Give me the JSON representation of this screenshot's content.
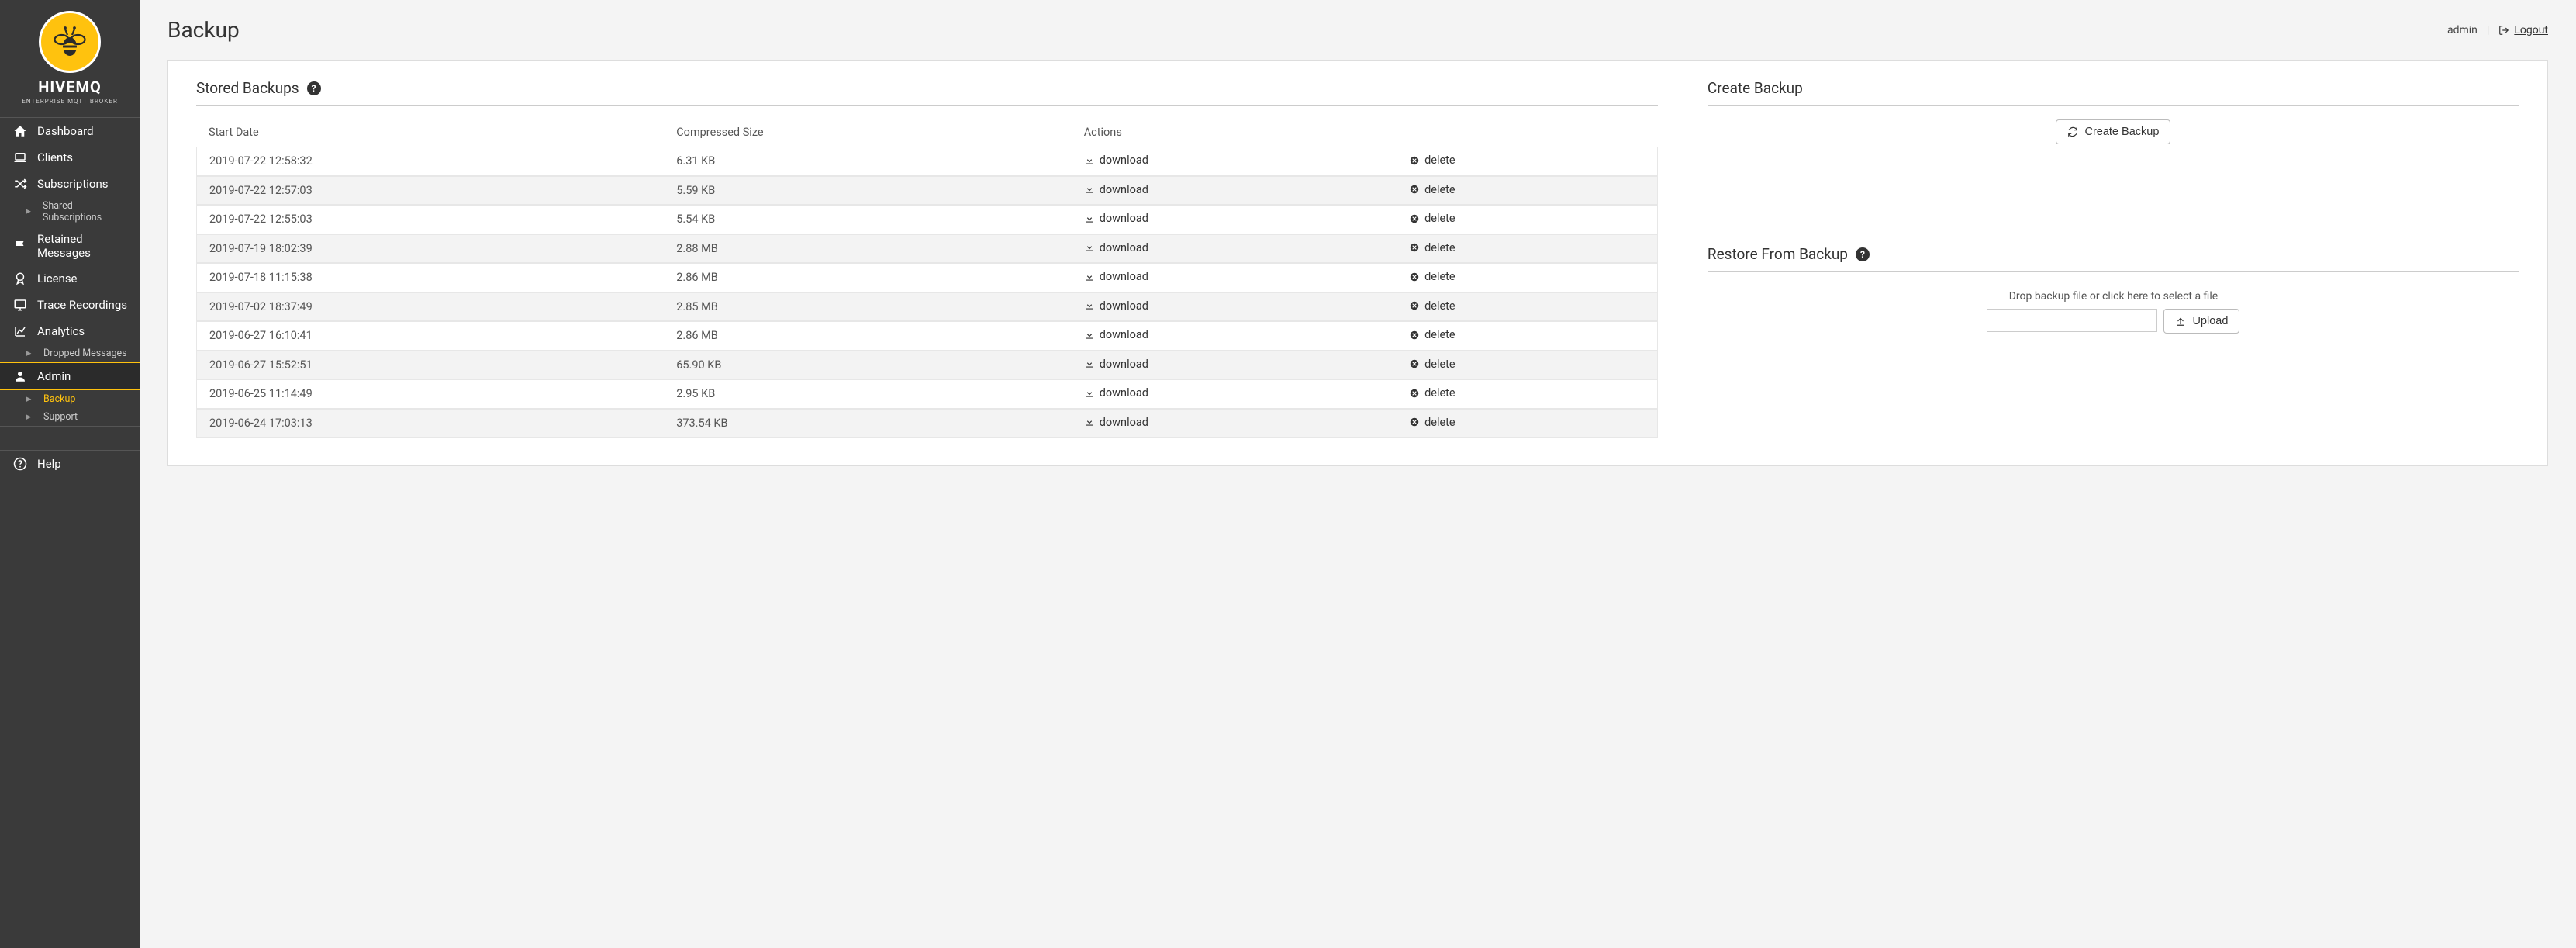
{
  "brand": {
    "name": "HIVEMQ",
    "tagline": "ENTERPRISE MQTT BROKER"
  },
  "nav": {
    "items": [
      {
        "label": "Dashboard",
        "icon": "home-icon"
      },
      {
        "label": "Clients",
        "icon": "laptop-icon"
      },
      {
        "label": "Subscriptions",
        "icon": "shuffle-icon"
      },
      {
        "label": "Retained Messages",
        "icon": "flag-icon"
      },
      {
        "label": "License",
        "icon": "award-icon"
      },
      {
        "label": "Trace Recordings",
        "icon": "display-icon"
      },
      {
        "label": "Analytics",
        "icon": "chart-icon"
      },
      {
        "label": "Admin",
        "icon": "user-icon"
      }
    ],
    "sub_subscriptions": "Shared Subscriptions",
    "sub_analytics": "Dropped Messages",
    "sub_admin_backup": "Backup",
    "sub_admin_support": "Support",
    "help": "Help"
  },
  "header": {
    "title": "Backup",
    "user": "admin",
    "logout": "Logout"
  },
  "stored": {
    "title": "Stored Backups",
    "columns": {
      "date": "Start Date",
      "size": "Compressed Size",
      "actions": "Actions"
    },
    "action_download": "download",
    "action_delete": "delete",
    "rows": [
      {
        "date": "2019-07-22 12:58:32",
        "size": "6.31 KB"
      },
      {
        "date": "2019-07-22 12:57:03",
        "size": "5.59 KB"
      },
      {
        "date": "2019-07-22 12:55:03",
        "size": "5.54 KB"
      },
      {
        "date": "2019-07-19 18:02:39",
        "size": "2.88 MB"
      },
      {
        "date": "2019-07-18 11:15:38",
        "size": "2.86 MB"
      },
      {
        "date": "2019-07-02 18:37:49",
        "size": "2.85 MB"
      },
      {
        "date": "2019-06-27 16:10:41",
        "size": "2.86 MB"
      },
      {
        "date": "2019-06-27 15:52:51",
        "size": "65.90 KB"
      },
      {
        "date": "2019-06-25 11:14:49",
        "size": "2.95 KB"
      },
      {
        "date": "2019-06-24 17:03:13",
        "size": "373.54 KB"
      }
    ]
  },
  "create": {
    "title": "Create Backup",
    "button": "Create Backup"
  },
  "restore": {
    "title": "Restore From Backup",
    "dropzone_label": "Drop backup file or click here to select a file",
    "upload_button": "Upload"
  }
}
